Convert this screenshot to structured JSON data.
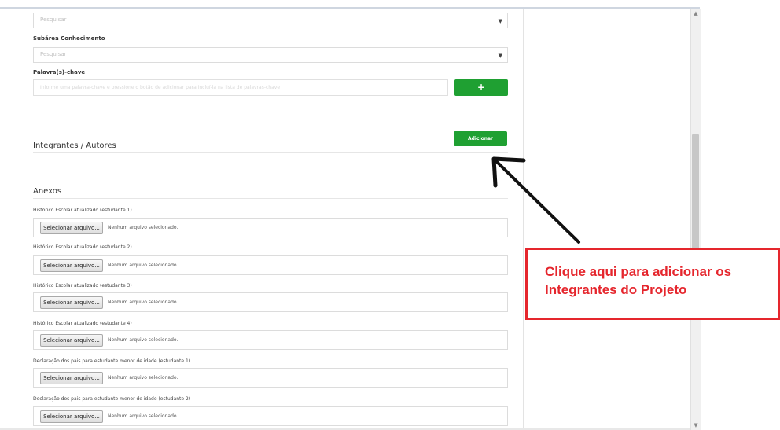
{
  "form": {
    "area_select": {
      "placeholder": "Pesquisar"
    },
    "subarea": {
      "label": "Subárea Conhecimento",
      "placeholder": "Pesquisar"
    },
    "keywords": {
      "label": "Palavra(s)-chave",
      "placeholder": "Informe uma palavra-chave e pressione o botão de adicionar para incluí-la na lista de palavras-chave",
      "add_symbol": "+"
    },
    "integrantes": {
      "title": "Integrantes / Autores",
      "add_label": "Adicionar"
    },
    "anexos": {
      "title": "Anexos",
      "choose_label": "Selecionar arquivo...",
      "no_file": "Nenhum arquivo selecionado.",
      "fields": [
        "Histórico Escolar atualizado (estudante 1)",
        "Histórico Escolar atualizado (estudante 2)",
        "Histórico Escolar atualizado (estudante 3)",
        "Histórico Escolar atualizado (estudante 4)",
        "Declaração dos pais para estudante menor de idade (estudante 1)",
        "Declaração dos pais para estudante menor de idade (estudante 2)"
      ]
    }
  },
  "annotation": {
    "text": "Clique aqui para adicionar os\nIntegrantes do Projeto",
    "color": "#e5262d"
  },
  "icons": {
    "caret": "caret-down-icon",
    "arrow": "arrow-pointer-icon"
  },
  "colors": {
    "accent": "#1fa032"
  }
}
